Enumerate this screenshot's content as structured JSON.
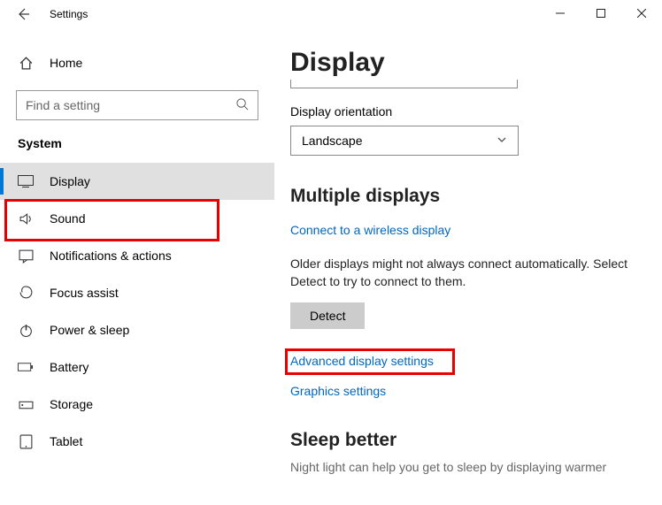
{
  "titlebar": {
    "app": "Settings"
  },
  "sidebar": {
    "home": "Home",
    "search_placeholder": "Find a setting",
    "section": "System",
    "items": [
      {
        "label": "Display"
      },
      {
        "label": "Sound"
      },
      {
        "label": "Notifications & actions"
      },
      {
        "label": "Focus assist"
      },
      {
        "label": "Power & sleep"
      },
      {
        "label": "Battery"
      },
      {
        "label": "Storage"
      },
      {
        "label": "Tablet"
      }
    ]
  },
  "main": {
    "title": "Display",
    "orientation_label": "Display orientation",
    "orientation_value": "Landscape",
    "multi_header": "Multiple displays",
    "wireless_link": "Connect to a wireless display",
    "detect_info": "Older displays might not always connect automatically. Select Detect to try to connect to them.",
    "detect_btn": "Detect",
    "adv_link": "Advanced display settings",
    "gfx_link": "Graphics settings",
    "sleep_header": "Sleep better",
    "sleep_text": "Night light can help you get to sleep by displaying warmer"
  }
}
